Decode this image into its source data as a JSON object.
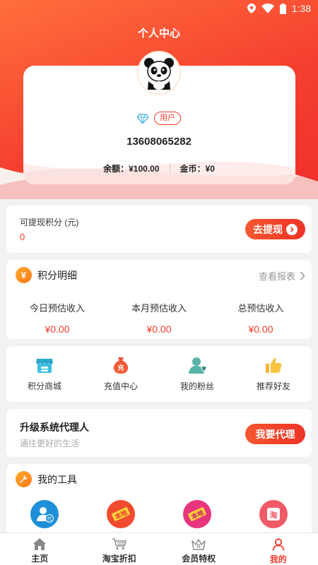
{
  "status_bar": {
    "time": "1:38",
    "icons": [
      "location-icon",
      "wifi-icon",
      "battery-icon"
    ]
  },
  "header": {
    "title": "个人中心"
  },
  "profile": {
    "badge": "用户",
    "phone": "13608065282",
    "balance_label": "余额：",
    "balance_value": "¥100.00",
    "coins_label": "金币：",
    "coins_value": "¥0"
  },
  "withdraw": {
    "label": "可提现积分 (元)",
    "value": "0",
    "button": "去提现"
  },
  "points": {
    "icon_glyph": "¥",
    "title": "积分明细",
    "report_link": "查看报表",
    "stats": [
      {
        "label": "今日预估收入",
        "value": "¥0.00"
      },
      {
        "label": "本月预估收入",
        "value": "¥0.00"
      },
      {
        "label": "总预估收入",
        "value": "¥0.00"
      }
    ]
  },
  "menu": {
    "items": [
      {
        "label": "积分商城",
        "icon": "shop-icon"
      },
      {
        "label": "充值中心",
        "icon": "money-bag-icon"
      },
      {
        "label": "我的粉丝",
        "icon": "fans-icon"
      },
      {
        "label": "推荐好友",
        "icon": "thumbs-up-icon"
      }
    ]
  },
  "agent": {
    "title": "升级系统代理人",
    "subtitle": "通往更好的生活",
    "button": "我要代理"
  },
  "tools": {
    "title": "我的工具",
    "items": [
      {
        "icon": "agent-user-icon",
        "glyph": "代"
      },
      {
        "icon": "local-badge-icon",
        "glyph": "本地"
      },
      {
        "icon": "local-badge-icon",
        "glyph": "本地"
      },
      {
        "icon": "taobao-icon",
        "glyph": "淘"
      }
    ]
  },
  "tabbar": {
    "items": [
      {
        "label": "主页",
        "icon": "home-icon"
      },
      {
        "label": "淘宝折扣",
        "icon": "cart-icon"
      },
      {
        "label": "会员特权",
        "icon": "crown-icon"
      },
      {
        "label": "我的",
        "icon": "person-icon",
        "active": true
      }
    ]
  },
  "colors": {
    "accent": "#ef3b2d",
    "header_gradient_start": "#ff6f3c",
    "header_gradient_end": "#ef2f2b"
  }
}
